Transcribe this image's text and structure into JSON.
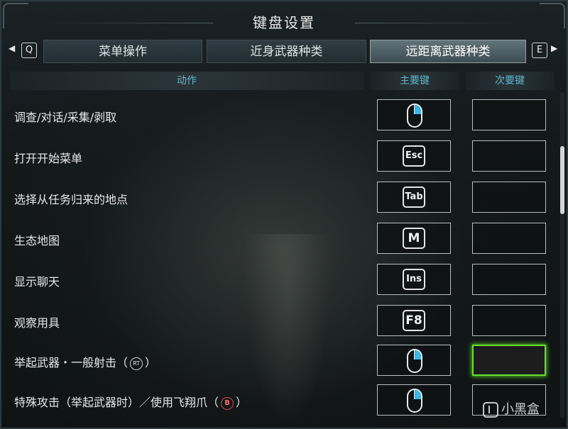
{
  "window": {
    "title": "键盘设置"
  },
  "tabs": {
    "prev_key": "Q",
    "next_key": "E",
    "items": [
      {
        "label": "菜单操作",
        "active": false
      },
      {
        "label": "近身武器种类",
        "active": false
      },
      {
        "label": "远距离武器种类",
        "active": true
      }
    ]
  },
  "columns": {
    "action": "动作",
    "primary": "主要键",
    "secondary": "次要键"
  },
  "rows": [
    {
      "action": "调查/对话/采集/剥取",
      "primary": "mouse-right",
      "secondary": ""
    },
    {
      "action": "打开开始菜单",
      "primary": "Esc",
      "secondary": ""
    },
    {
      "action": "选择从任务归来的地点",
      "primary": "Tab",
      "secondary": ""
    },
    {
      "action": "生态地图",
      "primary": "M",
      "secondary": ""
    },
    {
      "action": "显示聊天",
      "primary": "Ins",
      "secondary": ""
    },
    {
      "action": "观察用具",
      "primary": "F8",
      "secondary": ""
    },
    {
      "action": "举起武器・一般射击（",
      "action_suffix": "）",
      "action_glyph": "RT",
      "primary": "mouse-right",
      "secondary": "",
      "secondary_selected": true
    },
    {
      "action": "特殊攻击（举起武器时）／使用飞翔爪（",
      "action_suffix": "）",
      "action_glyph": "B",
      "primary": "mouse-right",
      "secondary": ""
    }
  ],
  "colors": {
    "accent": "#5db8cf",
    "selection": "#63e22c",
    "active_tab": "#62737a"
  },
  "watermark": {
    "text": "小黑盒"
  }
}
